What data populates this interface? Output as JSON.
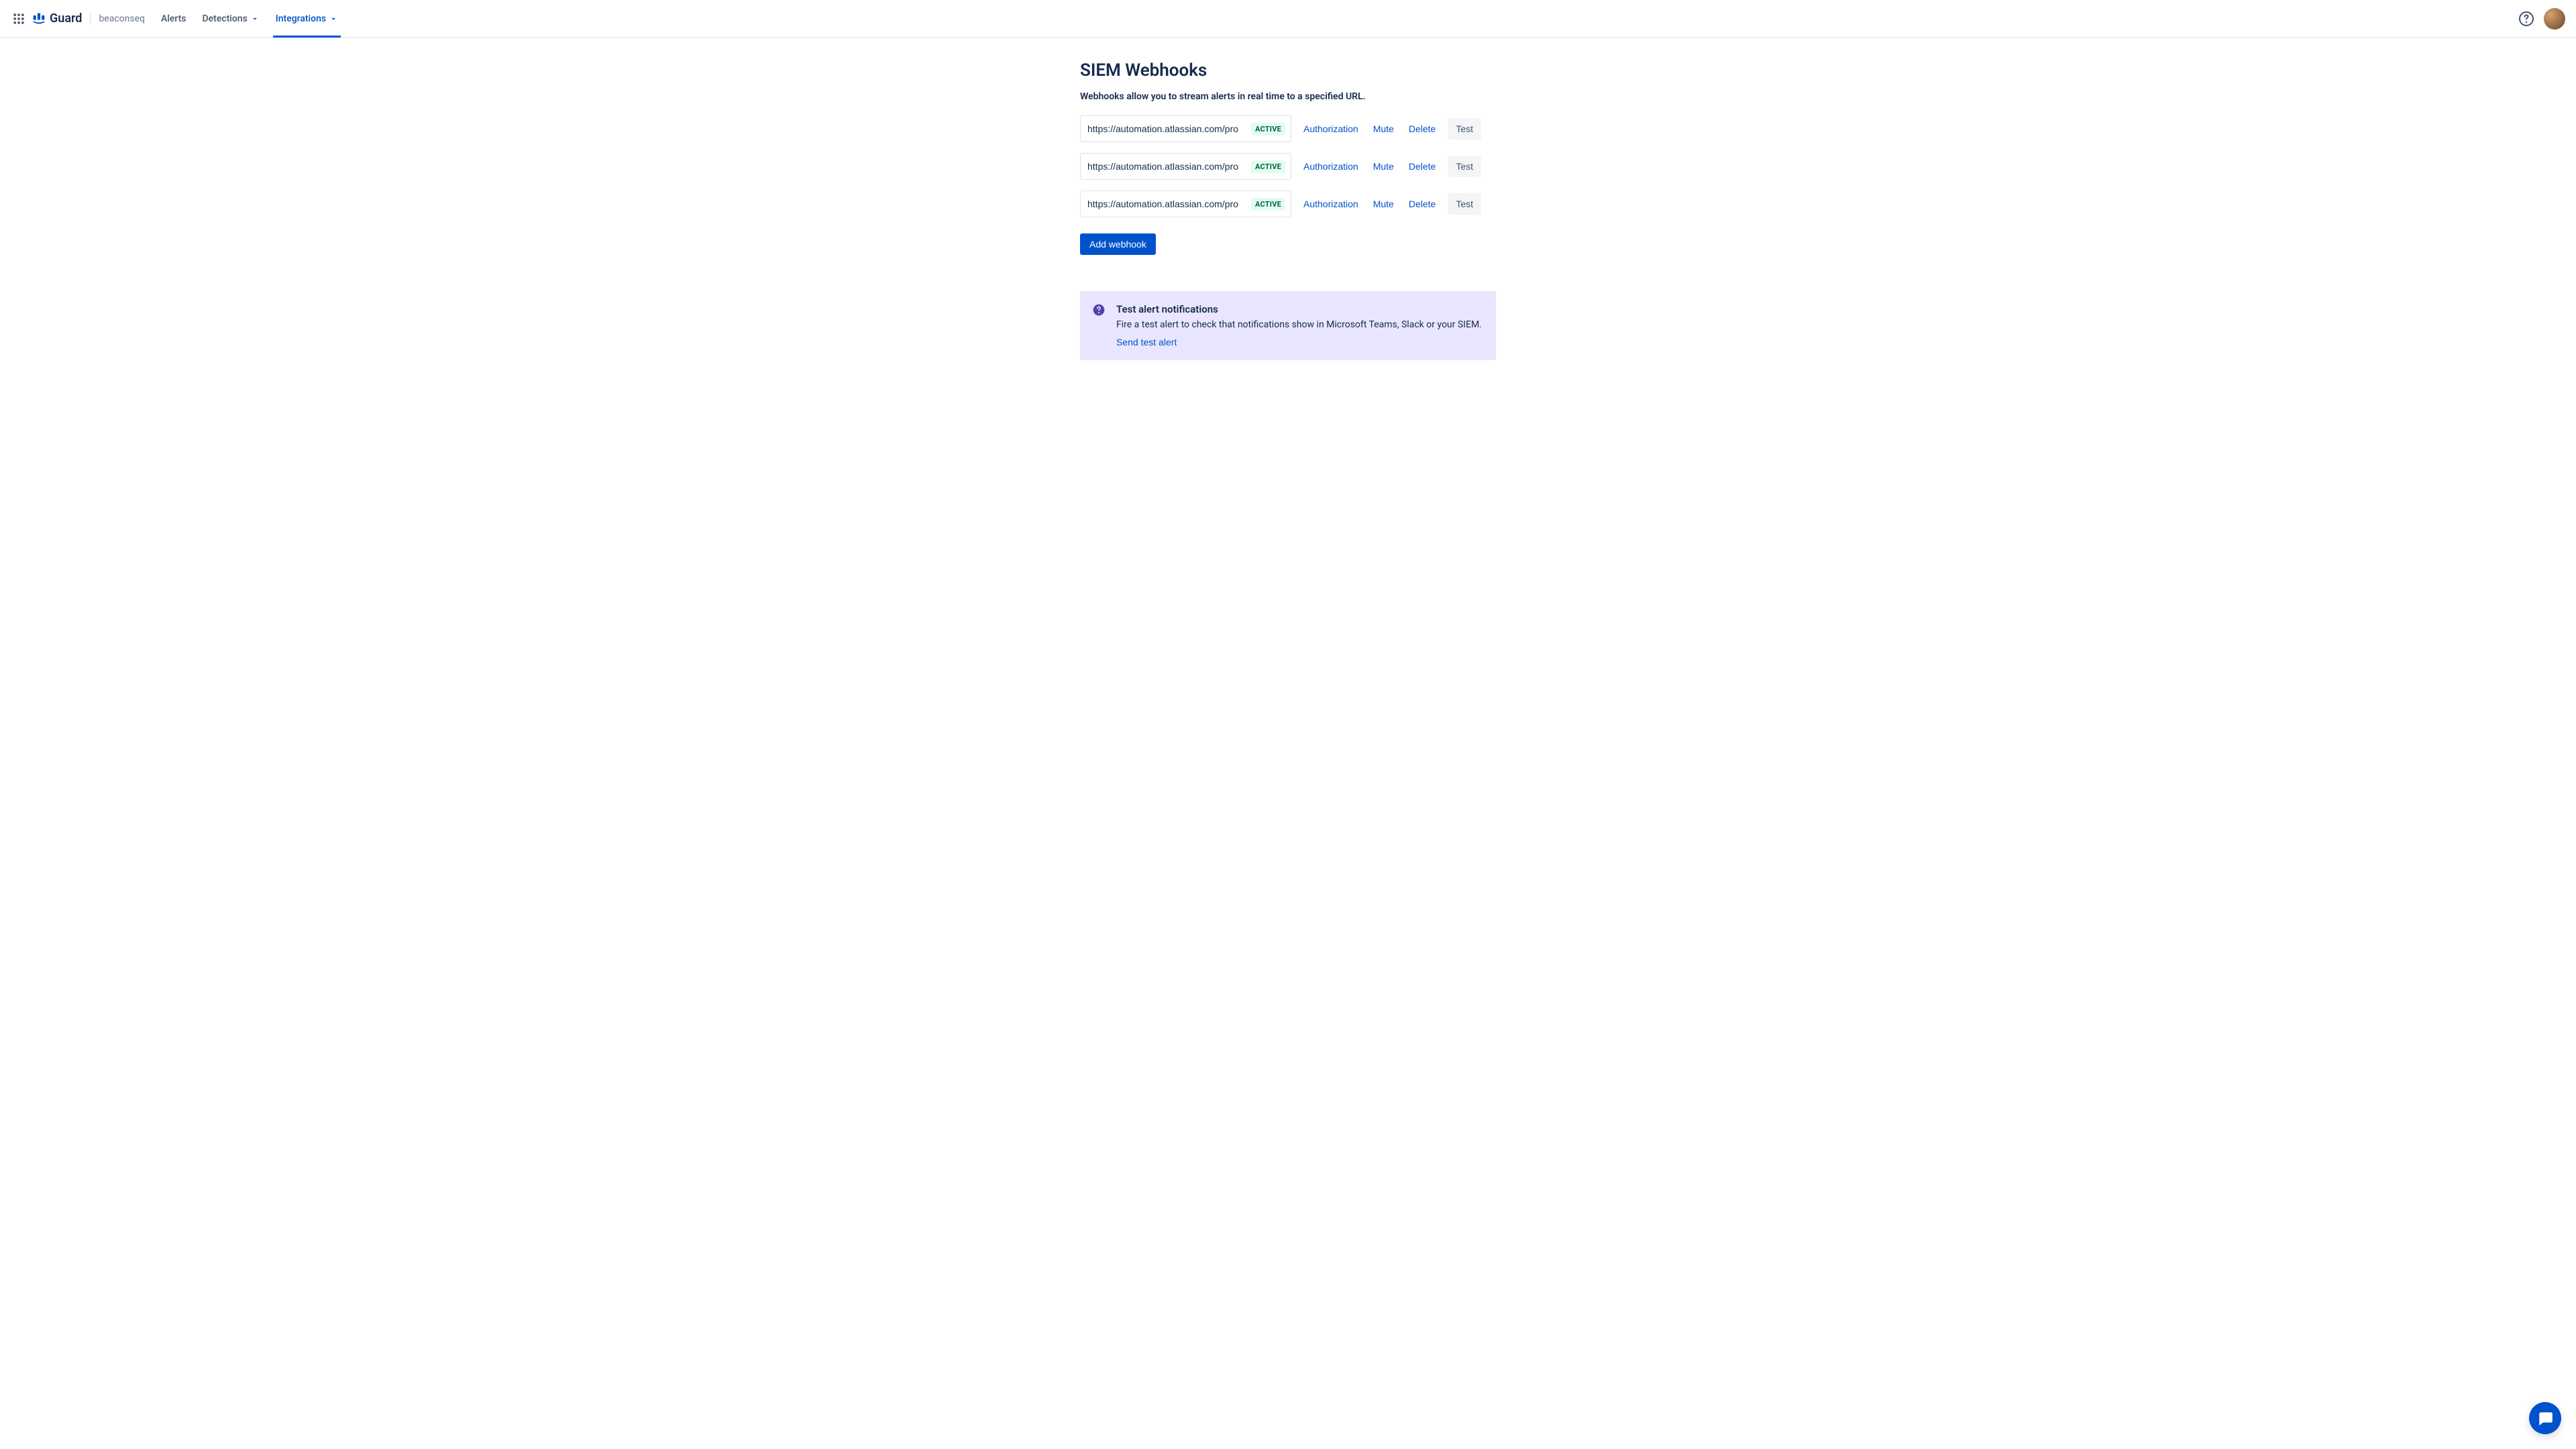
{
  "header": {
    "product_name": "Guard",
    "workspace": "beaconseq",
    "nav": [
      {
        "label": "Alerts",
        "dropdown": false,
        "active": false
      },
      {
        "label": "Detections",
        "dropdown": true,
        "active": false
      },
      {
        "label": "Integrations",
        "dropdown": true,
        "active": true
      }
    ]
  },
  "page": {
    "title": "SIEM Webhooks",
    "description": "Webhooks allow you to stream alerts in real time to a specified URL."
  },
  "webhooks": [
    {
      "url": "https://automation.atlassian.com/pro",
      "status": "ACTIVE",
      "authorization": "Authorization",
      "mute": "Mute",
      "delete": "Delete",
      "test": "Test"
    },
    {
      "url": "https://automation.atlassian.com/pro",
      "status": "ACTIVE",
      "authorization": "Authorization",
      "mute": "Mute",
      "delete": "Delete",
      "test": "Test"
    },
    {
      "url": "https://automation.atlassian.com/pro",
      "status": "ACTIVE",
      "authorization": "Authorization",
      "mute": "Mute",
      "delete": "Delete",
      "test": "Test"
    }
  ],
  "buttons": {
    "add_webhook": "Add webhook"
  },
  "info_panel": {
    "title": "Test alert notifications",
    "body": "Fire a test alert to check that notifications show in Microsoft Teams, Slack or your SIEM.",
    "link": "Send test alert"
  },
  "colors": {
    "primary": "#0052CC",
    "text": "#172B4D",
    "muted": "#6B778C",
    "success_fg": "#006644",
    "panel_bg": "#EAE6FF"
  }
}
